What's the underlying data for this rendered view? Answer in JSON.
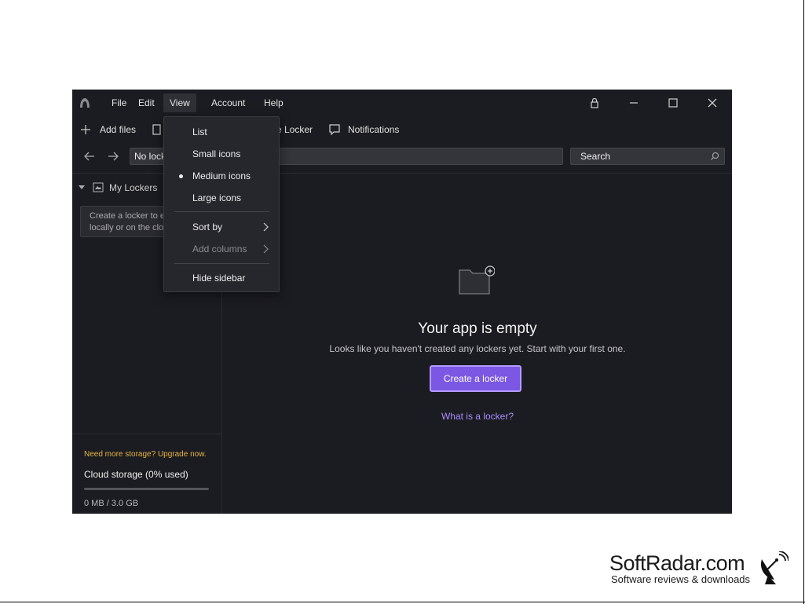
{
  "menubar": {
    "items": [
      "File",
      "Edit",
      "View",
      "Account",
      "Help"
    ]
  },
  "toolbar": {
    "add_files": "Add files",
    "locker_partial": "e Locker",
    "notifications": "Notifications"
  },
  "addressbar": {
    "path_text": "No lock",
    "search_placeholder": "Search"
  },
  "sidebar": {
    "tree_label": "My Lockers",
    "hint_line1": "Create a locker to e",
    "hint_line2": "locally or on the clo",
    "upgrade_text": "Need more storage? Upgrade now.",
    "storage_title": "Cloud storage (0% used)",
    "storage_used": "0 MB / 3.0 GB",
    "storage_fraction": 0
  },
  "main": {
    "empty_title": "Your app is empty",
    "empty_subtitle": "Looks like you haven't created any lockers yet. Start with your first one.",
    "create_button": "Create a locker",
    "what_link": "What is a locker?"
  },
  "view_menu": {
    "list": "List",
    "small_icons": "Small icons",
    "medium_icons": "Medium icons",
    "large_icons": "Large icons",
    "sort_by": "Sort by",
    "add_columns": "Add columns",
    "hide_sidebar": "Hide sidebar",
    "selected": "Medium icons"
  },
  "watermark": {
    "title": "SoftRadar.com",
    "tagline": "Software reviews & downloads"
  },
  "colors": {
    "app_bg": "#1b1c21",
    "accent": "#7b57e4",
    "link": "#a98bff",
    "upgrade": "#e8b341"
  }
}
